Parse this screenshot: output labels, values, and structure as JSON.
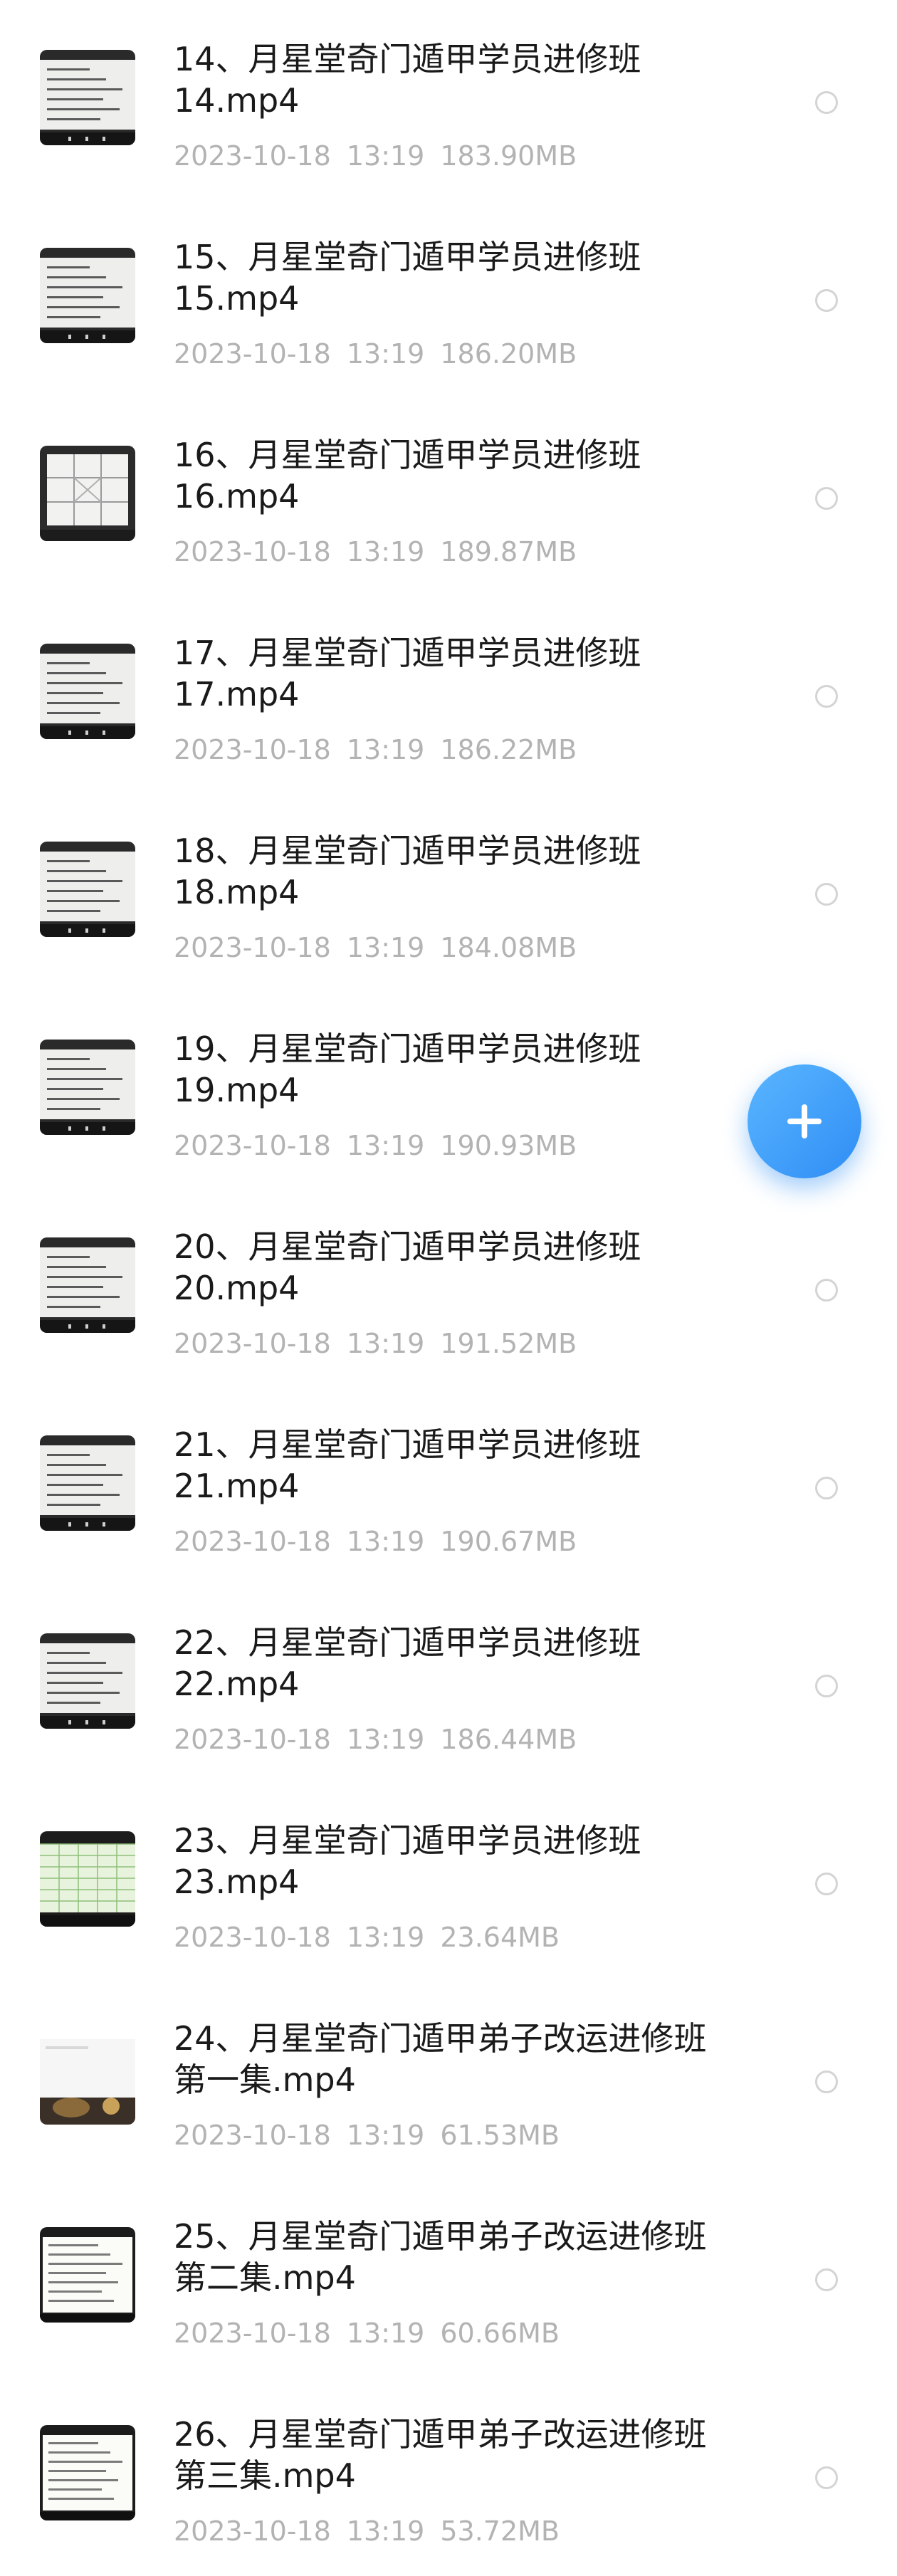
{
  "files": [
    {
      "name": "14、月星堂奇门遁甲学员进修班\n14.mp4",
      "date": "2023-10-18",
      "time": "13:19",
      "size": "183.90MB",
      "thumb": "handwriting-page"
    },
    {
      "name": "15、月星堂奇门遁甲学员进修班\n15.mp4",
      "date": "2023-10-18",
      "time": "13:19",
      "size": "186.20MB",
      "thumb": "handwriting-page"
    },
    {
      "name": "16、月星堂奇门遁甲学员进修班\n16.mp4",
      "date": "2023-10-18",
      "time": "13:19",
      "size": "189.87MB",
      "thumb": "nine-palace-grid"
    },
    {
      "name": "17、月星堂奇门遁甲学员进修班\n17.mp4",
      "date": "2023-10-18",
      "time": "13:19",
      "size": "186.22MB",
      "thumb": "handwriting-page"
    },
    {
      "name": "18、月星堂奇门遁甲学员进修班\n18.mp4",
      "date": "2023-10-18",
      "time": "13:19",
      "size": "184.08MB",
      "thumb": "handwriting-page"
    },
    {
      "name": "19、月星堂奇门遁甲学员进修班\n19.mp4",
      "date": "2023-10-18",
      "time": "13:19",
      "size": "190.93MB",
      "thumb": "handwriting-page"
    },
    {
      "name": "20、月星堂奇门遁甲学员进修班\n20.mp4",
      "date": "2023-10-18",
      "time": "13:19",
      "size": "191.52MB",
      "thumb": "handwriting-page"
    },
    {
      "name": "21、月星堂奇门遁甲学员进修班\n21.mp4",
      "date": "2023-10-18",
      "time": "13:19",
      "size": "190.67MB",
      "thumb": "handwriting-page"
    },
    {
      "name": "22、月星堂奇门遁甲学员进修班\n22.mp4",
      "date": "2023-10-18",
      "time": "13:19",
      "size": "186.44MB",
      "thumb": "handwriting-page"
    },
    {
      "name": "23、月星堂奇门遁甲学员进修班\n23.mp4",
      "date": "2023-10-18",
      "time": "13:19",
      "size": "23.64MB",
      "thumb": "green-table"
    },
    {
      "name": "24、月星堂奇门遁甲弟子改运进修班\n第一集.mp4",
      "date": "2023-10-18",
      "time": "13:19",
      "size": "61.53MB",
      "thumb": "room-scene"
    },
    {
      "name": "25、月星堂奇门遁甲弟子改运进修班\n第二集.mp4",
      "date": "2023-10-18",
      "time": "13:19",
      "size": "60.66MB",
      "thumb": "document-page"
    },
    {
      "name": "26、月星堂奇门遁甲弟子改运进修班\n第三集.mp4",
      "date": "2023-10-18",
      "time": "13:19",
      "size": "53.72MB",
      "thumb": "document-page"
    }
  ],
  "fab": {
    "icon": "plus-icon",
    "color": "#2f8df5"
  },
  "colors": {
    "title": "#1a1a1a",
    "meta": "#b3b3b3",
    "radio_border": "#d4d4d4"
  }
}
